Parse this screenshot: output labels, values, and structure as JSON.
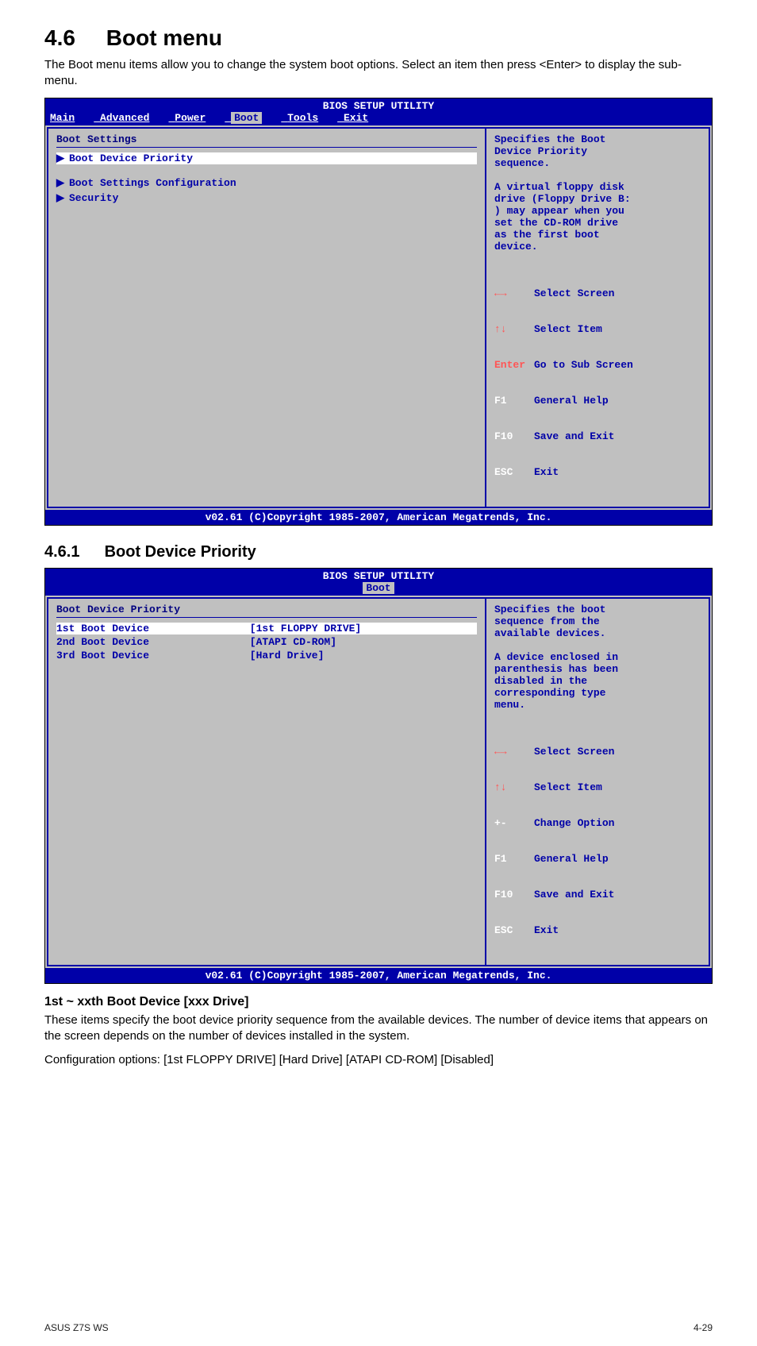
{
  "heading": {
    "number": "4.6",
    "title": "Boot menu"
  },
  "intro": "The Boot menu items allow you to change the system boot options. Select an item then press <Enter> to display the sub-menu.",
  "bios1": {
    "title": "BIOS SETUP UTILITY",
    "tabs": [
      "Main",
      "Advanced",
      "Power",
      "Boot",
      "Tools",
      "Exit"
    ],
    "selected_tab": "Boot",
    "left": {
      "heading": "Boot Settings",
      "items": [
        {
          "label": "Boot Device Priority",
          "highlight": true,
          "arrow": true
        },
        {
          "label": "Boot Settings Configuration",
          "highlight": false,
          "arrow": true
        },
        {
          "label": "Security",
          "highlight": false,
          "arrow": true
        }
      ]
    },
    "help": "Specifies the Boot\nDevice Priority\nsequence.\n\nA virtual floppy disk\ndrive (Floppy Drive B:\n) may appear when you\nset the CD-ROM drive\nas the first boot\ndevice.",
    "nav": [
      {
        "key_glyph": "←→",
        "key_type": "lr",
        "text": "Select Screen"
      },
      {
        "key_glyph": "↑↓",
        "key_type": "ud",
        "text": "Select Item"
      },
      {
        "key_glyph": "Enter",
        "key_type": "enter",
        "text": "Go to Sub Screen"
      },
      {
        "key_glyph": "F1",
        "key_type": "white",
        "text": "General Help"
      },
      {
        "key_glyph": "F10",
        "key_type": "white",
        "text": "Save and Exit"
      },
      {
        "key_glyph": "ESC",
        "key_type": "white",
        "text": "Exit"
      }
    ],
    "footer": "v02.61 (C)Copyright 1985-2007, American Megatrends, Inc."
  },
  "subheading": {
    "number": "4.6.1",
    "title": "Boot Device Priority"
  },
  "bios2": {
    "title": "BIOS SETUP UTILITY",
    "tabs": [
      "Boot"
    ],
    "selected_tab": "Boot",
    "left": {
      "heading": "Boot Device Priority",
      "rows": [
        {
          "label": "1st Boot Device",
          "value": "[1st FLOPPY DRIVE]",
          "highlight": true
        },
        {
          "label": "2nd Boot Device",
          "value": "[ATAPI CD-ROM]",
          "highlight": false
        },
        {
          "label": "3rd Boot Device",
          "value": "[Hard Drive]",
          "highlight": false
        }
      ]
    },
    "help": "Specifies the boot\nsequence from the\navailable devices.\n\nA device enclosed in\nparenthesis has been\ndisabled in the\ncorresponding type\nmenu.",
    "nav": [
      {
        "key_glyph": "←→",
        "key_type": "lr",
        "text": "Select Screen"
      },
      {
        "key_glyph": "↑↓",
        "key_type": "ud",
        "text": "Select Item"
      },
      {
        "key_glyph": "+-",
        "key_type": "white",
        "text": "Change Option"
      },
      {
        "key_glyph": "F1",
        "key_type": "white",
        "text": "General Help"
      },
      {
        "key_glyph": "F10",
        "key_type": "white",
        "text": "Save and Exit"
      },
      {
        "key_glyph": "ESC",
        "key_type": "white",
        "text": "Exit"
      }
    ],
    "footer": "v02.61 (C)Copyright 1985-2007, American Megatrends, Inc."
  },
  "subsub": "1st ~ xxth Boot Device [xxx Drive]",
  "para1": "These items specify the boot device priority sequence from the available devices. The number of device items that appears on the screen depends on the number of devices installed in the system.",
  "para2": "Configuration options: [1st FLOPPY DRIVE] [Hard Drive] [ATAPI CD-ROM] [Disabled]",
  "footer_left": "ASUS Z7S WS",
  "footer_right": "4-29"
}
